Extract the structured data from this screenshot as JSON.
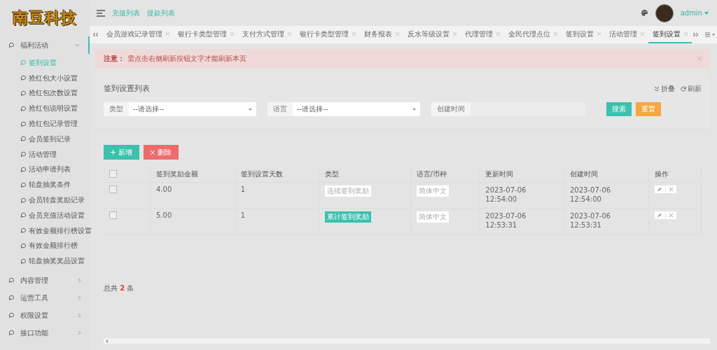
{
  "logo": {
    "text": "南豆科技"
  },
  "header": {
    "links": [
      "充值列表",
      "提款列表"
    ],
    "user": "admin"
  },
  "sidebar": {
    "groups": [
      {
        "label": "福利活动",
        "expanded": true,
        "children": [
          {
            "label": "签到设置",
            "selected": true
          },
          {
            "label": "抢红包大小设置",
            "selected": false
          },
          {
            "label": "抢红包次数设置",
            "selected": false
          },
          {
            "label": "抢红包说明设置",
            "selected": false
          },
          {
            "label": "抢红包记录管理",
            "selected": false
          },
          {
            "label": "会员签到记录",
            "selected": false
          },
          {
            "label": "活动管理",
            "selected": false
          },
          {
            "label": "活动申请列表",
            "selected": false
          },
          {
            "label": "轮盘抽奖条件",
            "selected": false
          },
          {
            "label": "会员转盘奖励记录",
            "selected": false
          },
          {
            "label": "会员充值活动设置",
            "selected": false
          },
          {
            "label": "有效金额排行榜设置",
            "selected": false
          },
          {
            "label": "有效金额排行榜",
            "selected": false
          },
          {
            "label": "轮盘抽奖奖品设置",
            "selected": false
          }
        ]
      },
      {
        "label": "内容管理",
        "expanded": false
      },
      {
        "label": "运营工具",
        "expanded": false
      },
      {
        "label": "权限设置",
        "expanded": false
      },
      {
        "label": "接口功能",
        "expanded": false
      }
    ]
  },
  "tabs": [
    {
      "label": "会员游戏记录管理",
      "selected": false
    },
    {
      "label": "银行卡类型管理",
      "selected": false
    },
    {
      "label": "支付方式管理",
      "selected": false
    },
    {
      "label": "银行卡类型管理",
      "selected": false
    },
    {
      "label": "财务报表",
      "selected": false
    },
    {
      "label": "反水等级设置",
      "selected": false
    },
    {
      "label": "代理管理",
      "selected": false
    },
    {
      "label": "全民代理点位",
      "selected": false
    },
    {
      "label": "签到设置",
      "selected": false
    },
    {
      "label": "活动管理",
      "selected": false
    },
    {
      "label": "签到设置",
      "selected": true
    }
  ],
  "alert": {
    "label": "注意：",
    "message": "需点击右侧刷新按钮文字才能刷新本页"
  },
  "panel": {
    "title": "签到设置列表",
    "actions": [
      "折叠",
      "刷新"
    ],
    "filters": [
      {
        "kind": "select",
        "label": "类型",
        "placeholder": "--请选择--"
      },
      {
        "kind": "select",
        "label": "语言",
        "placeholder": "--请选择--"
      },
      {
        "kind": "input",
        "label": "创建时间"
      }
    ],
    "buttons": [
      {
        "kind": "search",
        "label": "搜索"
      },
      {
        "kind": "reset",
        "label": "重置"
      }
    ]
  },
  "toolbar": [
    {
      "kind": "add",
      "label": "新增"
    },
    {
      "kind": "delete",
      "label": "删除"
    }
  ],
  "table": {
    "select_all_checked": false,
    "columns": [
      "签到奖励金额",
      "签到设置天数",
      "类型",
      "语言/币种",
      "更新时间",
      "创建时间",
      "操作"
    ],
    "rows": [
      {
        "checked": false,
        "amount": "4.00",
        "days": "1",
        "type": {
          "kind": "plain",
          "label": "连续签到奖励"
        },
        "language": "简体中文",
        "updated": "2023-07-06 12:54:00",
        "created": "2023-07-06 12:54:00"
      },
      {
        "checked": false,
        "amount": "5.00",
        "days": "1",
        "type": {
          "kind": "accent",
          "label": "累计签到奖励"
        },
        "language": "简体中文",
        "updated": "2023-07-06 12:53:31",
        "created": "2023-07-06 12:53:31"
      }
    ]
  },
  "footer": {
    "total": "总共 **2** 条"
  }
}
